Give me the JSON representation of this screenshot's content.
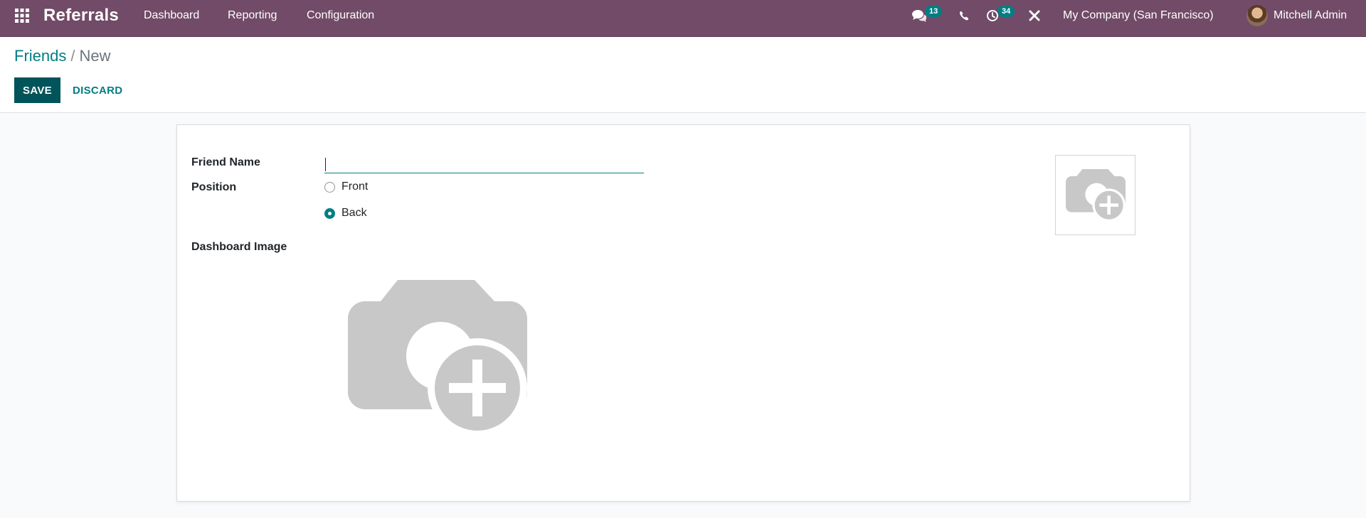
{
  "navbar": {
    "apps_icon": "grid-icon",
    "app_title": "Referrals",
    "menu": [
      "Dashboard",
      "Reporting",
      "Configuration"
    ],
    "messages_badge": "13",
    "activities_badge": "34",
    "company": "My Company (San Francisco)",
    "user": "Mitchell Admin",
    "color": "#714b67"
  },
  "breadcrumb": {
    "parent": "Friends",
    "separator": "/",
    "current": "New"
  },
  "actions": {
    "save": "SAVE",
    "discard": "DISCARD"
  },
  "form": {
    "friend_name_label": "Friend Name",
    "friend_name_value": "",
    "position_label": "Position",
    "position_options": [
      {
        "label": "Front",
        "checked": false
      },
      {
        "label": "Back",
        "checked": true
      }
    ],
    "dashboard_image_label": "Dashboard Image",
    "image_placeholder_icon": "camera-plus-icon"
  },
  "colors": {
    "accent": "#017e84",
    "save_button": "#00545a",
    "placeholder_gray": "#c8c8c8"
  }
}
